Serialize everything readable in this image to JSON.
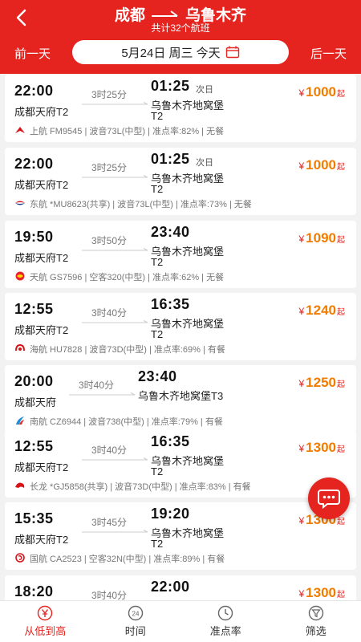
{
  "header": {
    "from": "成都",
    "to": "乌鲁木齐",
    "subtitle": "共计32个航班",
    "prev_day": "前一天",
    "next_day": "后一天",
    "date_text": "5月24日 周三 今天"
  },
  "flights": [
    {
      "dep_time": "22:00",
      "dep_airport": "成都天府T2",
      "duration": "3时25分",
      "arr_time": "01:25",
      "next_day": "次日",
      "arr_airport": "乌鲁木齐地窝堡",
      "arr_terminal": "T2",
      "price": "1000",
      "info": "上航 FM9545 | 波音73L(中型) | 准点率:82% | 无餐",
      "logo": "shanghai-airlines"
    },
    {
      "dep_time": "22:00",
      "dep_airport": "成都天府T2",
      "duration": "3时25分",
      "arr_time": "01:25",
      "next_day": "次日",
      "arr_airport": "乌鲁木齐地窝堡",
      "arr_terminal": "T2",
      "price": "1000",
      "info": "东航 *MU8623(共享) | 波音73L(中型) | 准点率:73% | 无餐",
      "logo": "china-eastern"
    },
    {
      "dep_time": "19:50",
      "dep_airport": "成都天府T2",
      "duration": "3时50分",
      "arr_time": "23:40",
      "next_day": "",
      "arr_airport": "乌鲁木齐地窝堡",
      "arr_terminal": "T2",
      "price": "1090",
      "info": "天航 GS7596 | 空客320(中型) | 准点率:62% | 无餐",
      "logo": "tianjin-airlines"
    },
    {
      "dep_time": "12:55",
      "dep_airport": "成都天府T2",
      "duration": "3时40分",
      "arr_time": "16:35",
      "next_day": "",
      "arr_airport": "乌鲁木齐地窝堡",
      "arr_terminal": "T2",
      "price": "1240",
      "info": "海航 HU7828 | 波音73D(中型) | 准点率:69% | 有餐",
      "logo": "hainan-airlines"
    },
    {
      "dep_time": "20:00",
      "dep_airport": "成都天府",
      "duration": "3时40分",
      "arr_time": "23:40",
      "next_day": "",
      "arr_airport": "乌鲁木齐地窝堡T3",
      "arr_terminal": "",
      "price": "1250",
      "info": "南航 CZ6944 | 波音738(中型) | 准点率:79% | 有餐",
      "logo": "china-southern"
    },
    {
      "dep_time": "12:55",
      "dep_airport": "成都天府T2",
      "duration": "3时40分",
      "arr_time": "16:35",
      "next_day": "",
      "arr_airport": "乌鲁木齐地窝堡",
      "arr_terminal": "T2",
      "price": "1300",
      "info": "长龙 *GJ5858(共享) | 波音73D(中型) | 准点率:83% | 有餐",
      "logo": "loong-air"
    },
    {
      "dep_time": "15:35",
      "dep_airport": "成都天府T2",
      "duration": "3时45分",
      "arr_time": "19:20",
      "next_day": "",
      "arr_airport": "乌鲁木齐地窝堡",
      "arr_terminal": "T2",
      "price": "1300",
      "info": "国航 CA2523 | 空客32N(中型) | 准点率:89% | 有餐",
      "logo": "air-china"
    },
    {
      "dep_time": "18:20",
      "dep_airport": "",
      "duration": "3时40分",
      "arr_time": "22:00",
      "next_day": "",
      "arr_airport": "",
      "arr_terminal": "",
      "price": "1300",
      "info": "",
      "logo": ""
    }
  ],
  "price_prefix": "¥",
  "price_suffix": "起",
  "bottom_tabs": [
    {
      "label": "从低到高",
      "icon": "yen-icon",
      "active": true
    },
    {
      "label": "时间",
      "icon": "clock-24-icon",
      "active": false
    },
    {
      "label": "准点率",
      "icon": "punctuality-icon",
      "active": false
    },
    {
      "label": "筛选",
      "icon": "filter-icon",
      "active": false
    }
  ],
  "colors": {
    "brand": "#e5231f",
    "price": "#f07c00"
  }
}
